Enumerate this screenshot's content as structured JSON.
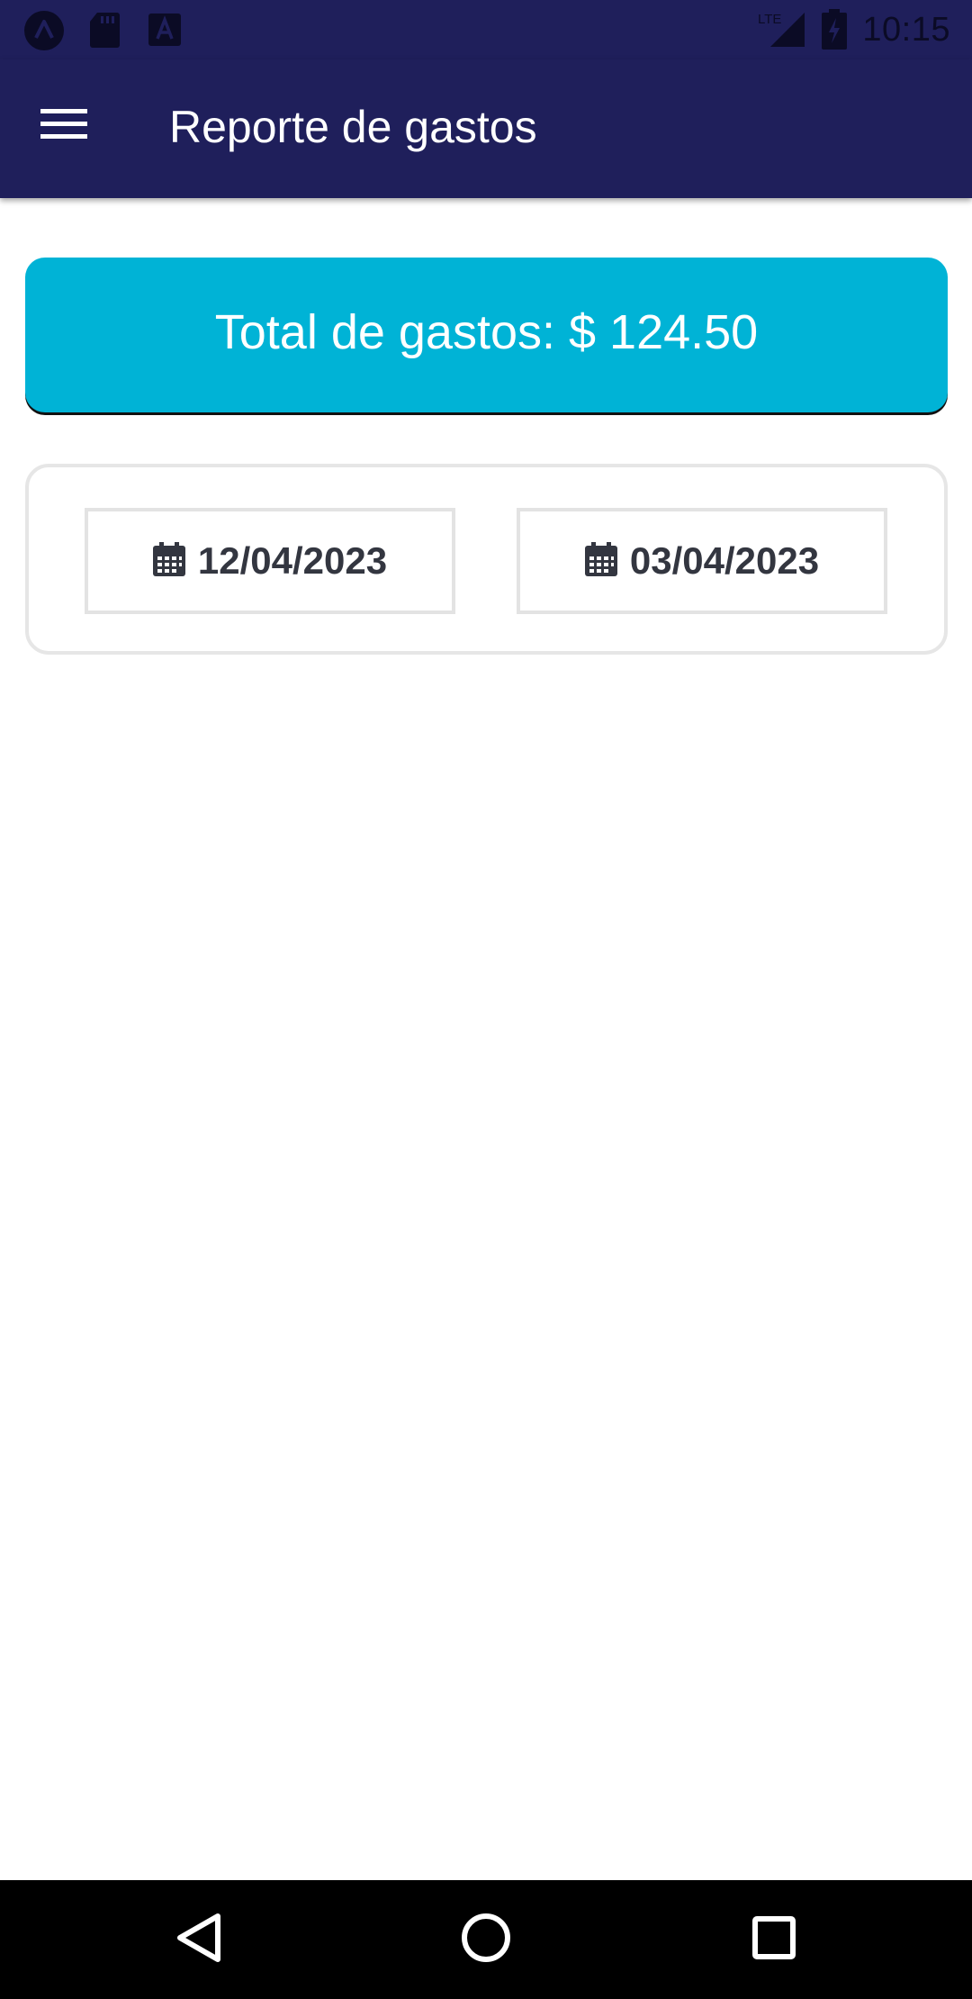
{
  "status_bar": {
    "time": "10:15",
    "icons": [
      "app-a-icon",
      "sd-card-icon",
      "keyboard-a-icon",
      "lte-signal-icon",
      "battery-charging-icon"
    ]
  },
  "app_bar": {
    "title": "Reporte de gastos",
    "menu_icon": "hamburger-menu-icon"
  },
  "summary": {
    "total_label": "Total de gastos: $ 124.50"
  },
  "date_filter": {
    "start_date": "12/04/2023",
    "end_date": "03/04/2023",
    "icon": "calendar-icon"
  },
  "nav_bar": {
    "buttons": [
      "back-icon",
      "home-icon",
      "recents-icon"
    ]
  },
  "colors": {
    "app_bar": "#1f1f5b",
    "accent": "#00b3d6",
    "text_dark": "#333640"
  }
}
